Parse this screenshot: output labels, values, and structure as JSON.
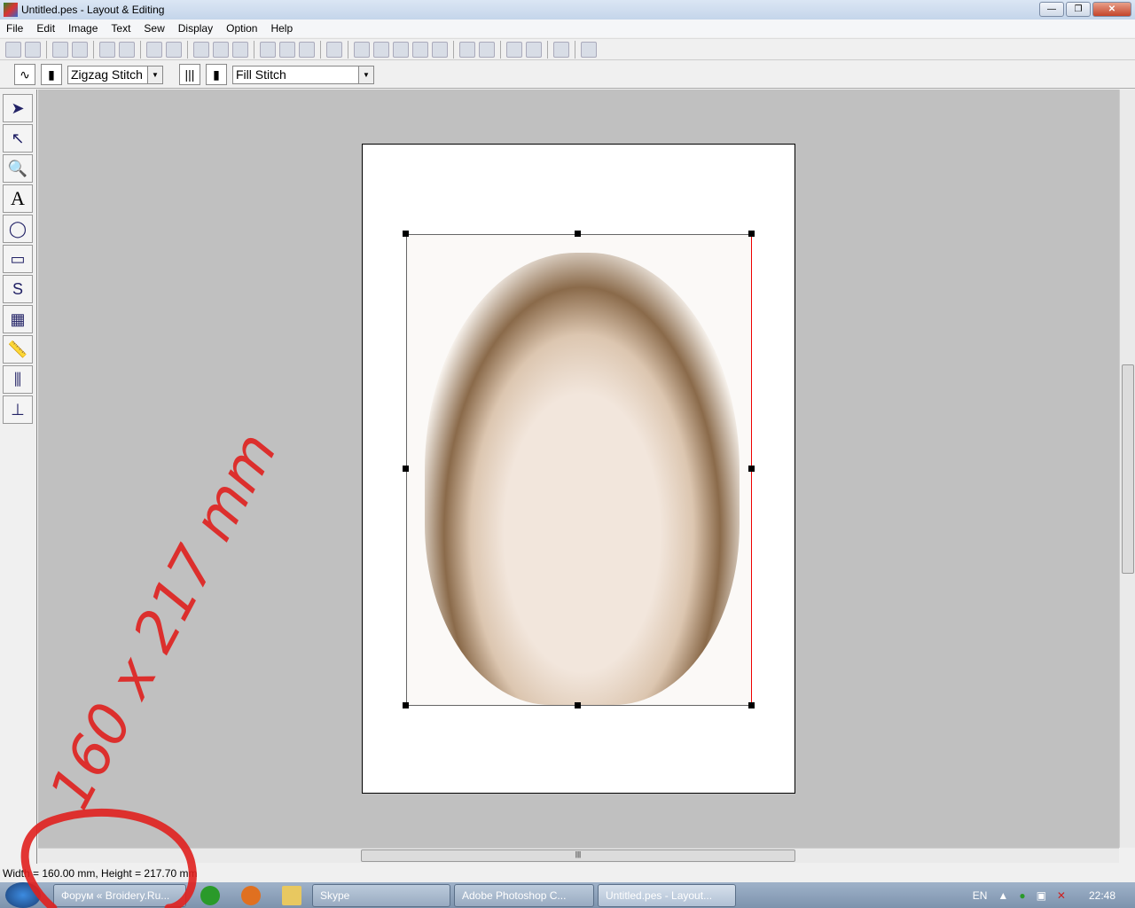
{
  "window": {
    "title": "Untitled.pes - Layout & Editing",
    "minimize": "—",
    "maximize": "❐",
    "close": "✕"
  },
  "menu": [
    "File",
    "Edit",
    "Image",
    "Text",
    "Sew",
    "Display",
    "Option",
    "Help"
  ],
  "toolbar2": {
    "line_stitch": "Zigzag Stitch",
    "fill_stitch": "Fill Stitch"
  },
  "status": {
    "text": "Width = 160.00 mm, Height = 217.70 mm"
  },
  "annotation": {
    "text": "160 x 217 mm"
  },
  "taskbar": {
    "tasks": [
      "Форум « Broidery.Ru...",
      "Skype",
      "Adobe Photoshop C...",
      "Untitled.pes - Layout..."
    ],
    "lang": "EN",
    "clock": "22:48"
  }
}
